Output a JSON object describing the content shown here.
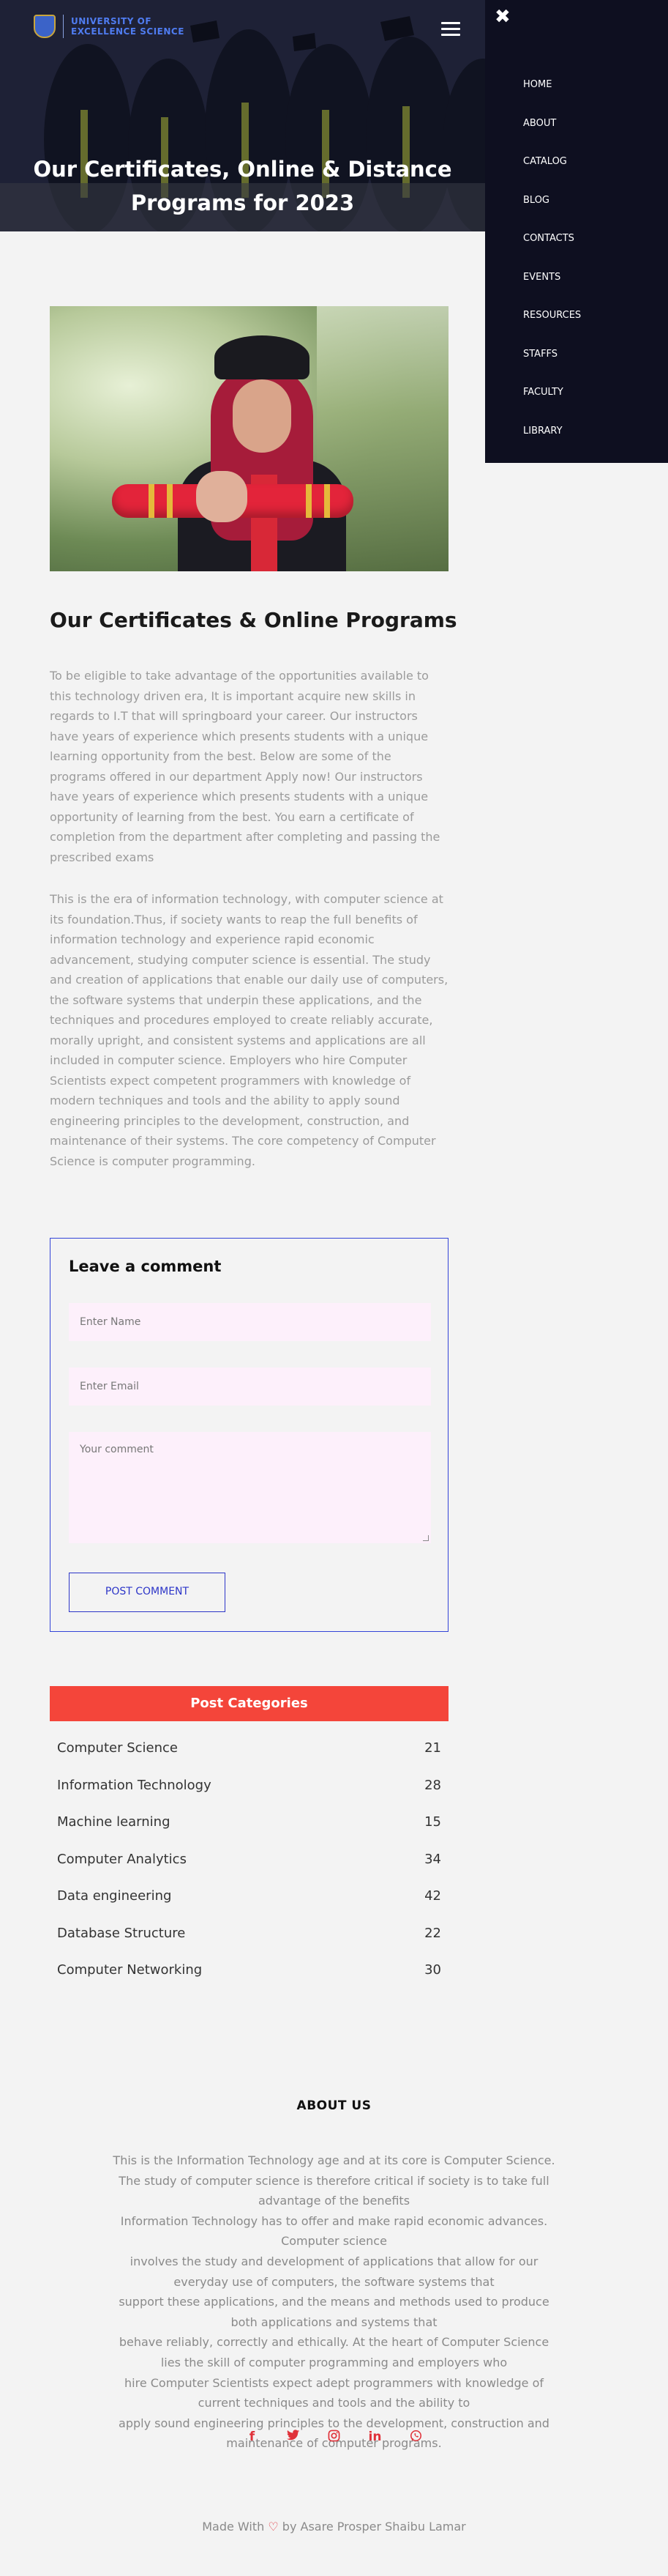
{
  "logo": {
    "line1": "UNIVERSITY OF",
    "line2": "EXCELLENCE SCIENCE"
  },
  "hero": {
    "title": "Our Certificates, Online & Distance Programs for 2023"
  },
  "menu": {
    "close_glyph": "✖",
    "items": [
      "HOME",
      "ABOUT",
      "CATALOG",
      "BLOG",
      "CONTACTS",
      "EVENTS",
      "RESOURCES",
      "STAFFS",
      "FACULTY",
      "LIBRARY"
    ]
  },
  "article": {
    "title": "Our Certificates & Online Programs",
    "para1": "To be eligible to take advantage of the opportunities available to this technology driven era, It is important acquire new skills in regards to I.T that will springboard your career. Our instructors have years of experience which presents students with a unique learning opportunity from the best. Below are some of the programs offered in our department Apply now! Our instructors have years of experience which presents students with a unique opportunity of learning from the best. You earn a certificate of completion from the department after completing and passing the prescribed exams",
    "para2": "This is the era of information technology, with computer science at its foundation.Thus, if society wants to reap the full benefits of information technology and experience rapid economic advancement, studying computer science is essential. The study and creation of applications that enable our daily use of computers, the software systems that underpin these applications, and the techniques and procedures employed to create reliably accurate, morally upright, and consistent systems and applications are all included in computer science. Employers who hire Computer Scientists expect competent programmers with knowledge of modern techniques and tools and the ability to apply sound engineering principles to the development, construction, and maintenance of their systems. The core competency of Computer Science is computer programming."
  },
  "comment": {
    "title": "Leave a comment",
    "name_placeholder": "Enter Name",
    "email_placeholder": "Enter Email",
    "comment_placeholder": "Your comment",
    "submit_label": "POST COMMENT"
  },
  "categories": {
    "title": "Post Categories",
    "items": [
      {
        "name": "Computer Science",
        "count": "21"
      },
      {
        "name": "Information Technology",
        "count": "28"
      },
      {
        "name": "Machine learning",
        "count": "15"
      },
      {
        "name": "Computer Analytics",
        "count": "34"
      },
      {
        "name": "Data engineering",
        "count": "42"
      },
      {
        "name": "Database Structure",
        "count": "22"
      },
      {
        "name": "Computer Networking",
        "count": "30"
      }
    ]
  },
  "footer": {
    "about_title": "ABOUT US",
    "about_lines": [
      "This is the Information Technology age and at its core is Computer Science.",
      "The study of computer science is therefore critical if society is to take full",
      "advantage of the benefits",
      "Information Technology has to offer and make rapid economic advances.",
      "Computer science",
      "involves the study and development of applications that allow for our",
      "everyday use of computers, the software systems that",
      "support these applications, and the means and methods used to produce",
      "both applications and systems that",
      "behave reliably, correctly and ethically. At the heart of Computer Science",
      "lies the skill of computer programming and employers who",
      "hire Computer Scientists expect adept programmers with knowledge of",
      "current techniques and tools and the ability to",
      "apply sound engineering principles to the development, construction and",
      "maintenance of computer programs."
    ],
    "socials": [
      {
        "icon": "facebook-icon",
        "glyph": "f"
      },
      {
        "icon": "twitter-icon",
        "glyph": "🐦"
      },
      {
        "icon": "instagram-icon",
        "glyph": "◎"
      },
      {
        "icon": "linkedin-icon",
        "glyph": "in"
      },
      {
        "icon": "whatsapp-icon",
        "glyph": "✆"
      }
    ],
    "made_with_prefix": "Made With",
    "heart": "♡",
    "made_with_suffix": "by Asare Prosper Shaibu Lamar"
  },
  "colors": {
    "accent_red": "#f4453a",
    "form_blue": "#3344d8",
    "menu_bg": "#0e0f20"
  }
}
